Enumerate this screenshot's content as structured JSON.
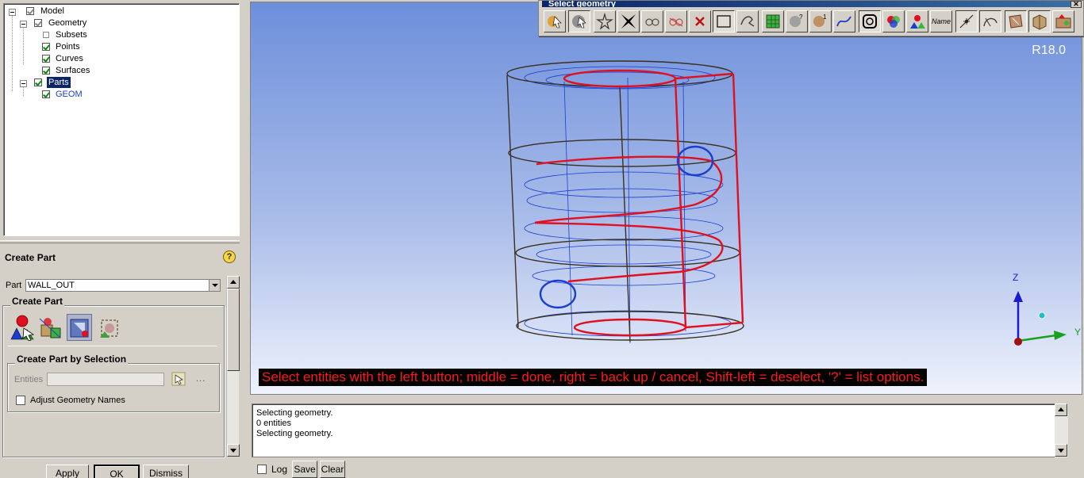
{
  "tree": {
    "items": [
      {
        "label": "Model",
        "checked": "grey",
        "expander": true
      },
      {
        "label": "Geometry",
        "checked": "grey",
        "expander": true
      },
      {
        "label": "Subsets",
        "checked": "none"
      },
      {
        "label": "Points",
        "checked": "checked"
      },
      {
        "label": "Curves",
        "checked": "checked"
      },
      {
        "label": "Surfaces",
        "checked": "checked"
      },
      {
        "label": "Parts",
        "checked": "checked",
        "expander": true,
        "selected": true
      },
      {
        "label": "GEOM",
        "checked": "checked",
        "blue": true
      }
    ]
  },
  "panel": {
    "title": "Create Part",
    "help": "?",
    "part_label": "Part",
    "part_value": "WALL_OUT",
    "group_title": "Create Part",
    "subgroup_title": "Create Part by Selection",
    "entities_label": "Entities",
    "entities_more": "...",
    "adjust_label": "Adjust Geometry Names"
  },
  "buttons": {
    "apply": "Apply",
    "ok": "OK",
    "dismiss": "Dismiss"
  },
  "viewport": {
    "version": "R18.0",
    "hint": "Select entities with the left button; middle = done, right = back up / cancel, Shift-left = deselect, '?' = list options.",
    "axis_z": "Z",
    "axis_y": "Y"
  },
  "selbar": {
    "title": "Select geometry",
    "close": "✕",
    "name_label": "Name"
  },
  "messages": {
    "lines": [
      "Selecting geometry.",
      "0 entities",
      "Selecting geometry."
    ],
    "log_label": "Log",
    "save": "Save",
    "clear": "Clear"
  },
  "colors": {
    "selection_red": "#e01020",
    "curve_blue": "#1a3fd0",
    "outline_dark": "#3a3020",
    "hint_text": "#ff1a1a"
  }
}
